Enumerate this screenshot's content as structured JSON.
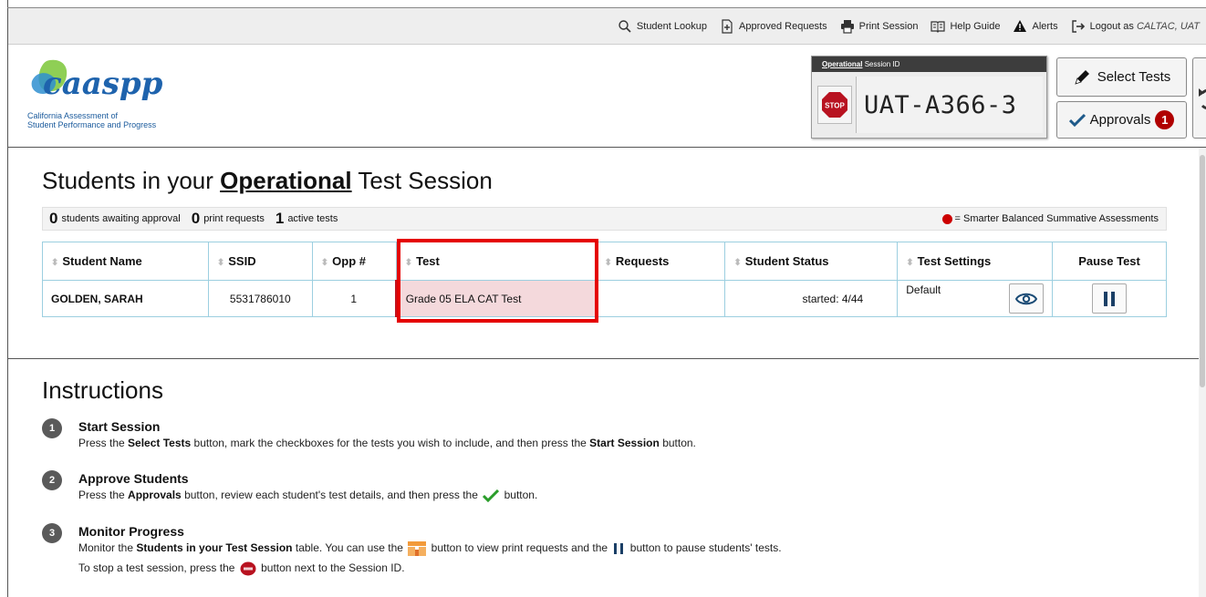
{
  "topnav": {
    "student_lookup": "Student Lookup",
    "approved_requests": "Approved Requests",
    "print_session": "Print Session",
    "help_guide": "Help Guide",
    "alerts": "Alerts",
    "logout": "Logout as",
    "logout_user": "CALTAC, UAT"
  },
  "logo": {
    "text": "caaspp",
    "subtitle_line1": "California Assessment of",
    "subtitle_line2": "Student Performance and Progress"
  },
  "session": {
    "label_type": "Operational",
    "label_rest": "Session ID",
    "stop_text": "STOP",
    "id": "UAT-A366-3"
  },
  "buttons": {
    "select_tests": "Select Tests",
    "approvals": "Approvals",
    "approvals_count": "1"
  },
  "students_section": {
    "title_pre": "Students in your",
    "title_bold": "Operational",
    "title_post": "Test Session",
    "awaiting_count": "0",
    "awaiting_label": "students awaiting approval",
    "print_count": "0",
    "print_label": "print requests",
    "active_count": "1",
    "active_label": "active tests",
    "legend": "= Smarter Balanced Summative Assessments"
  },
  "table": {
    "headers": [
      "Student Name",
      "SSID",
      "Opp #",
      "Test",
      "Requests",
      "Student Status",
      "Test Settings",
      "Pause Test"
    ],
    "rows": [
      {
        "name": "GOLDEN, SARAH",
        "ssid": "5531786010",
        "opp": "1",
        "test": "Grade 05 ELA CAT Test",
        "requests": "",
        "status": "started: 4/44",
        "settings": "Default"
      }
    ]
  },
  "instructions": {
    "title": "Instructions",
    "steps": [
      {
        "num": "1",
        "heading": "Start Session",
        "d1": "Press the",
        "b1": "Select Tests",
        "d2": "button, mark the checkboxes for the tests you wish to include, and then press the",
        "b2": "Start Session",
        "d3": "button."
      },
      {
        "num": "2",
        "heading": "Approve Students",
        "d1": "Press the",
        "b1": "Approvals",
        "d2": "button, review each student's test details, and then press the",
        "d3": "button."
      },
      {
        "num": "3",
        "heading": "Monitor Progress",
        "d1": "Monitor the",
        "b1": "Students in your Test Session",
        "d2": "table. You can use the",
        "d3": "button to view print requests and the",
        "d4": "button to pause students' tests.",
        "e1": "To stop a test session, press the",
        "e2": "button next to the Session ID."
      }
    ]
  },
  "colors": {
    "accent_red": "#c3141e",
    "highlight_box": "#e50000",
    "table_border": "#9ccfe0",
    "check_green": "#2a9d2a"
  }
}
